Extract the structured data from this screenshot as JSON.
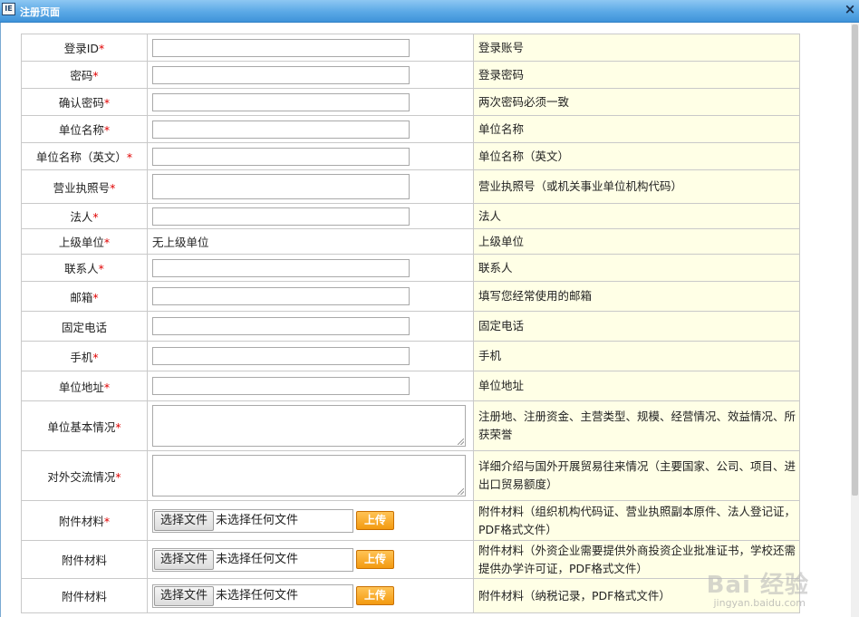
{
  "window": {
    "title": "注册页面",
    "icon": "app-icon",
    "icon_text": "IE"
  },
  "close_glyph": "×",
  "required_mark": "*",
  "rows": [
    {
      "label": "登录ID",
      "required": true,
      "type": "text",
      "desc": "登录账号",
      "h": 30
    },
    {
      "label": "密码",
      "required": true,
      "type": "text",
      "desc": "登录密码",
      "h": 30
    },
    {
      "label": "确认密码",
      "required": true,
      "type": "text",
      "desc": "两次密码必须一致",
      "h": 30
    },
    {
      "label": "单位名称",
      "required": true,
      "type": "text",
      "desc": "单位名称",
      "h": 30
    },
    {
      "label": "单位名称（英文）",
      "required": true,
      "type": "text",
      "desc": "单位名称（英文）",
      "h": 30
    },
    {
      "label": "营业执照号",
      "required": true,
      "type": "text-tall",
      "desc": "营业执照号（或机关事业单位机构代码）",
      "h": 37
    },
    {
      "label": "法人",
      "required": true,
      "type": "text",
      "desc": "法人",
      "h": 28
    },
    {
      "label": "上级单位",
      "required": true,
      "type": "static",
      "value": "无上级单位",
      "desc": "上级单位",
      "h": 28
    },
    {
      "label": "联系人",
      "required": true,
      "type": "text",
      "desc": "联系人",
      "h": 30
    },
    {
      "label": "邮箱",
      "required": true,
      "type": "text",
      "desc": "填写您经常使用的邮箱",
      "h": 33
    },
    {
      "label": "固定电话",
      "required": false,
      "type": "text",
      "desc": "固定电话",
      "h": 33
    },
    {
      "label": "手机",
      "required": true,
      "type": "text",
      "desc": "手机",
      "h": 33
    },
    {
      "label": "单位地址",
      "required": true,
      "type": "text",
      "desc": "单位地址",
      "h": 33
    },
    {
      "label": "单位基本情况",
      "required": true,
      "type": "textarea",
      "desc": "注册地、注册资金、主营类型、规模、经营情况、效益情况、所获荣誉",
      "h": 55
    },
    {
      "label": "对外交流情况",
      "required": true,
      "type": "textarea",
      "desc": "详细介绍与国外开展贸易往来情况（主要国家、公司、项目、进出口贸易额度）",
      "h": 55
    },
    {
      "label": "附件材料",
      "required": true,
      "type": "file",
      "desc": "附件材料（组织机构代码证、营业执照副本原件、法人登记证，PDF格式文件）",
      "h": 44
    },
    {
      "label": "附件材料",
      "required": false,
      "type": "file",
      "desc": "附件材料（外资企业需要提供外商投资企业批准证书，学校还需提供办学许可证，PDF格式文件）",
      "h": 42
    },
    {
      "label": "附件材料",
      "required": false,
      "type": "file",
      "desc": "附件材料（纳税记录，PDF格式文件）",
      "h": 38
    }
  ],
  "file": {
    "choose_label": "选择文件",
    "no_file_text": "未选择任何文件",
    "upload_label": "上传"
  },
  "watermark": {
    "text": "Bai 经验",
    "sub": "jingyan.baidu.com"
  },
  "colors": {
    "desc_bg": "#ffffe6",
    "required": "#e00000",
    "upload": "#f39a10",
    "titlebar": "#5aa8e6"
  }
}
